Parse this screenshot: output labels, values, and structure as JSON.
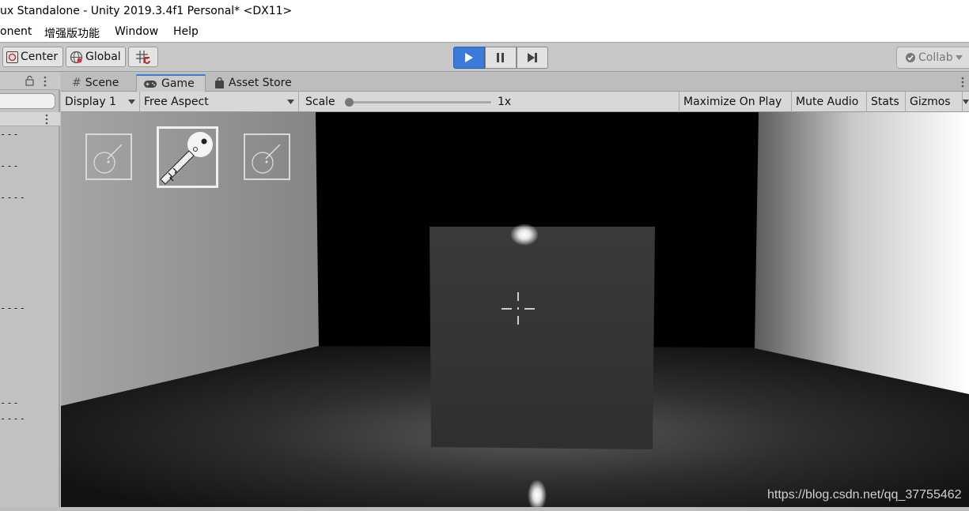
{
  "window": {
    "title": "ux Standalone - Unity 2019.3.4f1 Personal* <DX11>"
  },
  "menu": [
    {
      "label": "onent"
    },
    {
      "label": "增强版功能"
    },
    {
      "label": "Window"
    },
    {
      "label": "Help"
    }
  ],
  "toolbar": {
    "pivot_label": "Center",
    "space_label": "Global",
    "collab_label": "Collab"
  },
  "tabs": [
    {
      "label": "Scene"
    },
    {
      "label": "Game"
    },
    {
      "label": "Asset Store"
    }
  ],
  "game_bar": {
    "display": "Display 1",
    "aspect": "Free Aspect",
    "scale_label": "Scale",
    "scale_value": "1x",
    "maximize": "Maximize On Play",
    "mute": "Mute Audio",
    "stats": "Stats",
    "gizmos": "Gizmos"
  },
  "left_panel": {
    "dashes": [
      "---",
      "---",
      "----",
      "----",
      "---",
      "----"
    ]
  },
  "inventory": [
    {
      "icon": "key-icon",
      "selected": false
    },
    {
      "icon": "key-icon",
      "selected": true
    },
    {
      "icon": "key-icon",
      "selected": false
    }
  ],
  "watermark": "https://blog.csdn.net/qq_37755462",
  "colors": {
    "accent": "#3a7ad8"
  }
}
